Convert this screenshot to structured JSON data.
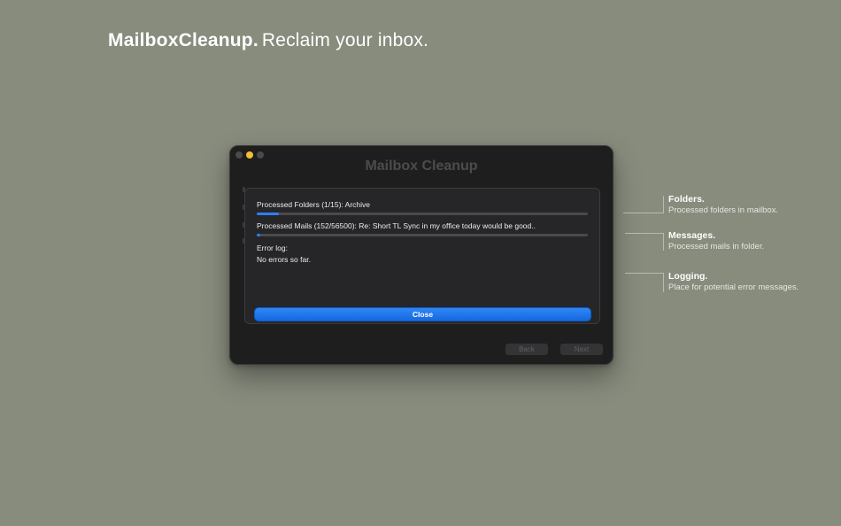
{
  "headline": {
    "brand": "MailboxCleanup.",
    "tagline": "Reclaim your inbox."
  },
  "window": {
    "title": "Mailbox Cleanup",
    "traffic_lights": [
      "close",
      "minimize",
      "zoom"
    ],
    "sheet": {
      "folders_label": "Processed Folders (1/15): Archive",
      "folders_progress": 0.0667,
      "mails_label": "Processed Mails (152/56500): Re: Short TL Sync in my office today would be good..",
      "mails_progress": 0.0027,
      "error_log_label": "Error log:",
      "error_log_text": "No errors so far.",
      "close_label": "Close"
    },
    "back_label": "Back",
    "next_label": "Next"
  },
  "callouts": [
    {
      "title": "Folders.",
      "desc": "Processed folders in mailbox."
    },
    {
      "title": "Messages.",
      "desc": "Processed mails in folder."
    },
    {
      "title": "Logging.",
      "desc": "Place for potential error messages."
    }
  ],
  "colors": {
    "accent": "#2d7ff9",
    "background": "#878c7d",
    "window": "#1e1e1f",
    "minimize": "#f4bf30"
  }
}
